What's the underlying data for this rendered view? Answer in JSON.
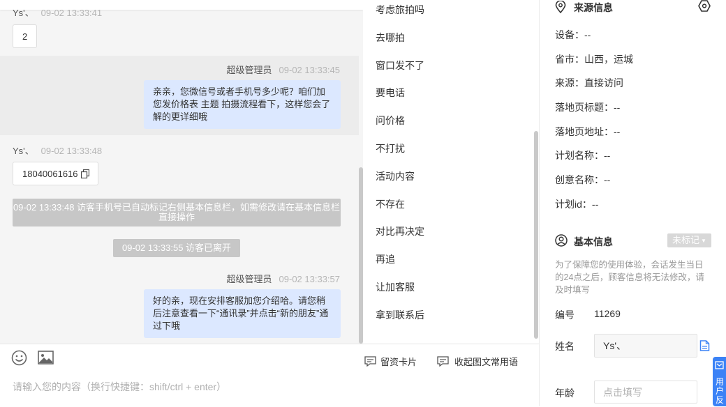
{
  "chat": {
    "messages": [
      {
        "sender": "Ys'、",
        "time": "09-02 13:33:41",
        "text": "2"
      },
      {
        "sender": "超级管理员",
        "time": "09-02 13:33:45",
        "text": "亲亲，您微信号或者手机号多少呢？咱们加您发价格表 主题 拍摄流程看下，这样您会了解的更详细哦"
      },
      {
        "sender": "Ys'、",
        "time": "09-02 13:33:48",
        "text": "18040061616"
      },
      {
        "system": "09-02 13:33:48 访客手机号已自动标记右侧基本信息栏，如需修改请在基本信息栏直接操作"
      },
      {
        "system": "09-02 13:33:55 访客已离开"
      },
      {
        "sender": "超级管理员",
        "time": "09-02 13:33:57",
        "text": "好的亲，现在安排客服加您介绍哈。请您稍后注意查看一下“通讯录”并点击“新的朋友”通过下哦"
      }
    ]
  },
  "input": {
    "emoji_icon": "smile-icon",
    "image_icon": "image-icon",
    "lead_card_label": "留资卡片",
    "collapse_label": "收起图文常用语",
    "placeholder": "请输入您的内容（换行快捷键：shift/ctrl + enter）"
  },
  "quick_replies": [
    "考虑旅拍吗",
    "去哪拍",
    "窗口发不了",
    "要电话",
    "问价格",
    "不打扰",
    "活动内容",
    "不存在",
    "对比再决定",
    "再追",
    "让加客服",
    "拿到联系后"
  ],
  "source": {
    "title": "来源信息",
    "rows": [
      {
        "label": "设备：",
        "value": "--"
      },
      {
        "label": "省市：",
        "value": "山西，运城"
      },
      {
        "label": "来源：",
        "value": "直接访问"
      },
      {
        "label": "落地页标题：",
        "value": "--"
      },
      {
        "label": "落地页地址：",
        "value": "--"
      },
      {
        "label": "计划名称：",
        "value": "--"
      },
      {
        "label": "创意名称：",
        "value": "--"
      },
      {
        "label": "计划id：",
        "value": "--"
      }
    ]
  },
  "basic": {
    "title": "基本信息",
    "tag_label": "未标记",
    "notice": "为了保障您的使用体验，会话发生当日的24点之后，顾客信息将无法修改，请及时填写",
    "id_label": "编号",
    "id_value": "11269",
    "name_label": "姓名",
    "name_value": "Ys'、",
    "age_label": "年龄",
    "age_placeholder": "点击填写"
  },
  "side_tab": {
    "label": "用户反"
  },
  "colors": {
    "accent": "#3b82f6",
    "out_bubble": "#dce8ff",
    "system_note": "#c7c7c7"
  }
}
